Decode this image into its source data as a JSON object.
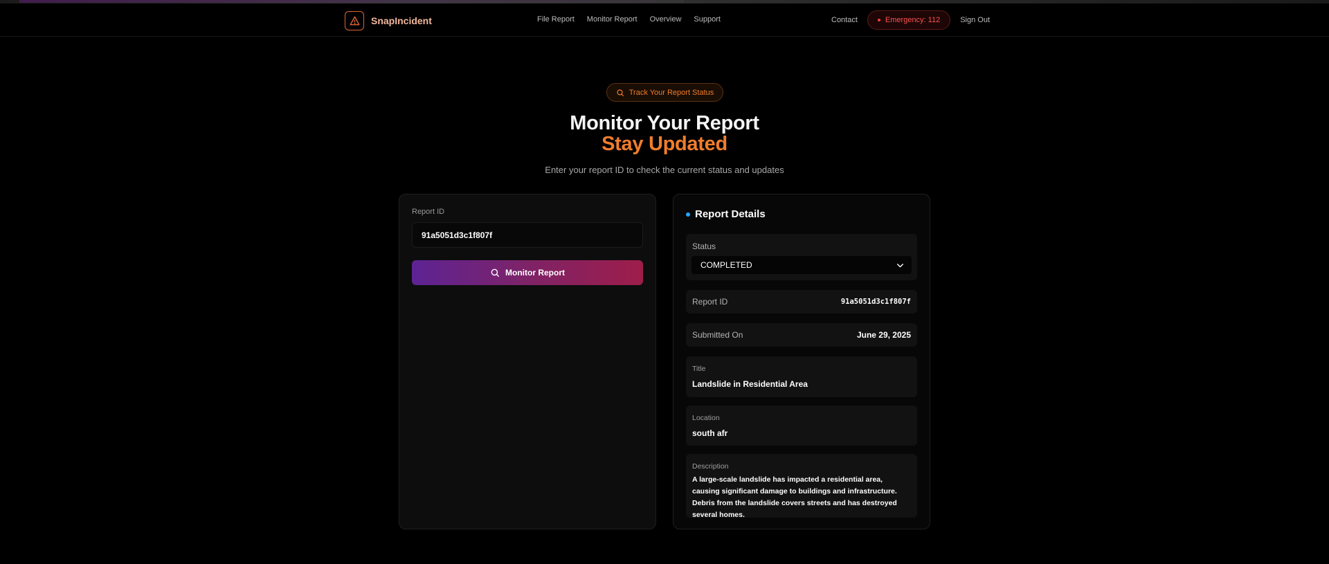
{
  "header": {
    "brand": "SnapIncident",
    "nav": [
      "File Report",
      "Monitor Report",
      "Overview",
      "Support"
    ],
    "contact": "Contact",
    "emergency": "Emergency: 112",
    "sign_out": "Sign Out"
  },
  "hero": {
    "badge": "Track Your Report Status",
    "title_line1": "Monitor Your Report",
    "title_line2": "Stay Updated",
    "subtitle": "Enter your report ID to check the current status and updates"
  },
  "form": {
    "label": "Report ID",
    "value": "91a5051d3c1f807f",
    "button_label": "Monitor Report"
  },
  "details": {
    "heading": "Report Details",
    "status_label": "Status",
    "status_value": "COMPLETED",
    "report_id_label": "Report ID",
    "report_id_value": "91a5051d3c1f807f",
    "submitted_label": "Submitted On",
    "submitted_value": "June 29, 2025",
    "title_label": "Title",
    "title_value": "Landslide in Residential Area",
    "location_label": "Location",
    "location_value": "south afr",
    "description_label": "Description",
    "description_value": "A large-scale landslide has impacted a residential area, causing significant damage to buildings and infrastructure. Debris from the landslide covers streets and has destroyed several homes."
  },
  "colors": {
    "accent_orange": "#f07d2d",
    "emergency_red": "#ff5252",
    "button_gradient_start": "#5d2394",
    "button_gradient_end": "#9e1d4a",
    "details_dot": "#22a6ff"
  },
  "icons": {
    "brand": "warning-triangle-icon",
    "badge": "search-icon",
    "button": "search-icon",
    "status_dropdown": "chevron-down-icon"
  }
}
